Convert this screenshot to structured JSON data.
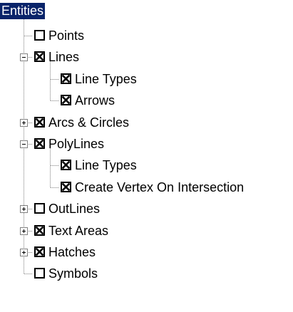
{
  "tree": {
    "root": {
      "label": "Entities",
      "selected": true,
      "highlight_color": "#0a246a"
    },
    "items": [
      {
        "label": "Points",
        "level": 1,
        "checked": false,
        "expander": "none"
      },
      {
        "label": "Lines",
        "level": 1,
        "checked": true,
        "expander": "collapse"
      },
      {
        "label": "Line Types",
        "level": 2,
        "checked": true,
        "expander": "none"
      },
      {
        "label": "Arrows",
        "level": 2,
        "checked": true,
        "expander": "none"
      },
      {
        "label": "Arcs & Circles",
        "level": 1,
        "checked": true,
        "expander": "expand"
      },
      {
        "label": "PolyLines",
        "level": 1,
        "checked": true,
        "expander": "collapse"
      },
      {
        "label": "Line Types",
        "level": 2,
        "checked": true,
        "expander": "none"
      },
      {
        "label": "Create Vertex On Intersection",
        "level": 2,
        "checked": true,
        "expander": "none"
      },
      {
        "label": "OutLines",
        "level": 1,
        "checked": false,
        "expander": "expand"
      },
      {
        "label": "Text Areas",
        "level": 1,
        "checked": true,
        "expander": "expand"
      },
      {
        "label": "Hatches",
        "level": 1,
        "checked": true,
        "expander": "expand"
      },
      {
        "label": "Symbols",
        "level": 1,
        "checked": false,
        "expander": "none"
      }
    ]
  },
  "colors": {
    "tree_line": "#808080",
    "checkbox_border": "#000000",
    "selection_text": "#ffffff"
  },
  "icons": {
    "checkbox_checked": "x-mark",
    "expander_expand": "plus",
    "expander_collapse": "minus"
  }
}
